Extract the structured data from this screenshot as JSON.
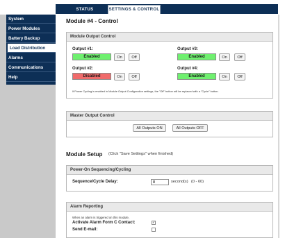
{
  "tabs": [
    {
      "label": "STATUS",
      "active": false
    },
    {
      "label": "SETTINGS & CONTROL",
      "active": true
    }
  ],
  "sidebar": {
    "items": [
      {
        "label": "System",
        "active": false
      },
      {
        "label": "Power Modules",
        "active": false
      },
      {
        "label": "Battery Backup",
        "active": false
      },
      {
        "label": "Load Distribution",
        "active": true
      },
      {
        "label": "Alarms",
        "active": false
      },
      {
        "label": "Communications",
        "active": false
      },
      {
        "label": "Help",
        "active": false
      }
    ]
  },
  "page": {
    "title": "Module #4 - Control"
  },
  "module_output_control": {
    "header": "Module Output Control",
    "outputs": [
      {
        "label": "Output #1:",
        "state": "Enabled",
        "on_label": "On",
        "off_label": "Off"
      },
      {
        "label": "Output #2:",
        "state": "Disabled",
        "on_label": "On",
        "off_label": "Off"
      },
      {
        "label": "Output #3:",
        "state": "Enabled",
        "on_label": "On",
        "off_label": "Off"
      },
      {
        "label": "Output #4:",
        "state": "Enabled",
        "on_label": "On",
        "off_label": "Off"
      }
    ],
    "note": "If Power Cycling is enabled in Module Output Configuration settings, the \"Off\" button will be replaced with a \"Cycle\" button."
  },
  "master_output_control": {
    "header": "Master Output Control",
    "all_on_label": "All Outputs ON",
    "all_off_label": "All Outputs OFF"
  },
  "module_setup": {
    "title": "Module Setup",
    "hint": "(Click \"Save Settings\" when finished)"
  },
  "power_on_sequencing": {
    "header": "Power-On Sequencing/Cycling",
    "delay_label": "Sequence/Cycle Delay:",
    "delay_value": "8",
    "unit": "second(s)",
    "range": "(0 - 60)"
  },
  "alarm_reporting": {
    "header": "Alarm Reporting",
    "description": "When an alarm is triggered on this module,",
    "activate_label": "Activate Alarm Form C Contact:",
    "activate_checked": true,
    "email_label": "Send E-mail:",
    "email_checked": false
  },
  "colors": {
    "nav_bg": "#0d2f56",
    "enabled": "#6ff06f",
    "disabled": "#f06b6b"
  }
}
